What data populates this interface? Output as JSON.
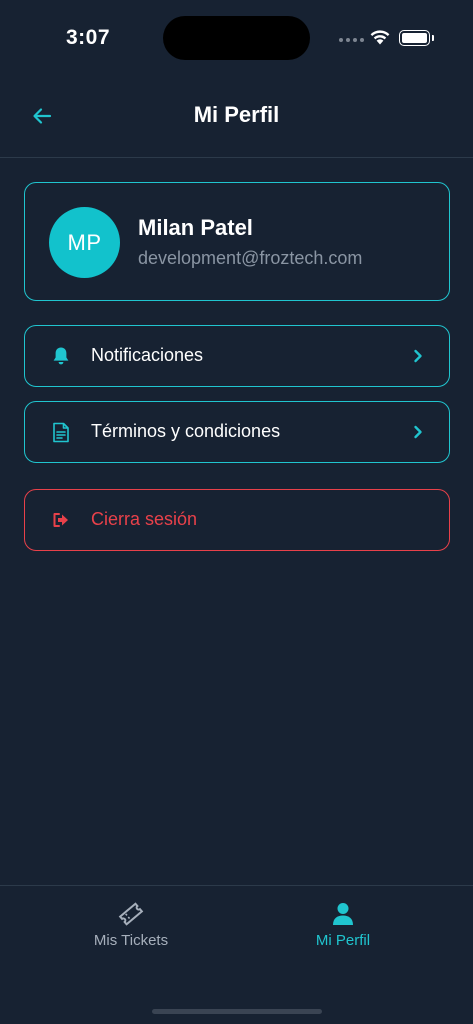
{
  "status_bar": {
    "time": "3:07"
  },
  "header": {
    "title": "Mi Perfil"
  },
  "profile": {
    "initials": "MP",
    "name": "Milan Patel",
    "email": "development@froztech.com"
  },
  "menu": {
    "items": [
      {
        "label": "Notificaciones",
        "icon": "bell-icon"
      },
      {
        "label": "Términos y condiciones",
        "icon": "document-icon"
      }
    ],
    "logout": {
      "label": "Cierra sesión",
      "icon": "logout-icon"
    }
  },
  "tab_bar": {
    "tabs": [
      {
        "label": "Mis Tickets",
        "icon": "ticket-icon",
        "active": false
      },
      {
        "label": "Mi Perfil",
        "icon": "user-icon",
        "active": true
      }
    ]
  },
  "colors": {
    "background": "#172232",
    "accent": "#20c5cf",
    "danger": "#e8414a",
    "muted": "#8a95a3"
  }
}
